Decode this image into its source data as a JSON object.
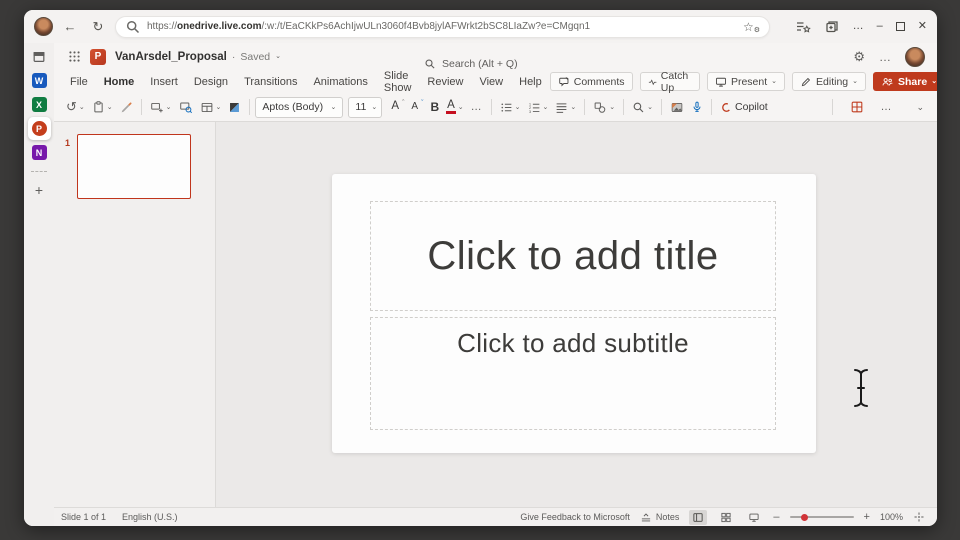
{
  "browser": {
    "url": {
      "prefix": "https://",
      "domain": "onedrive.live.com",
      "path": "/:w:/t/EaCKkPs6AchIjwULn3060f4Bvb8jylAFWrkt2bSC8LIaZw?e=CMgqn1"
    },
    "back_glyph": "←",
    "refresh_glyph": "↻",
    "more_glyph": "…",
    "minimize_glyph": "–",
    "close_glyph": "✕"
  },
  "app_rail": {
    "word_letter": "W",
    "excel_letter": "X",
    "powerpoint_letter": "P",
    "onenote_letter": "N",
    "new_button": "+"
  },
  "header": {
    "title": "VanArsdel_Proposal",
    "separator": "·",
    "save_status": "Saved",
    "search_placeholder": "Search (Alt + Q)",
    "gear_glyph": "⚙",
    "more_glyph": "…",
    "chevron": "⌄"
  },
  "menu": {
    "tabs": [
      "File",
      "Home",
      "Insert",
      "Design",
      "Transitions",
      "Animations",
      "Slide Show",
      "Review",
      "View",
      "Help"
    ],
    "active_tab": "Home",
    "comments": "Comments",
    "catch_up": "Catch Up",
    "present": "Present",
    "editing": "Editing",
    "share": "Share",
    "chevron": "⌄"
  },
  "ribbon": {
    "undo_glyph": "↺",
    "font_name": "Aptos (Body)",
    "font_size": "11",
    "grow_font": "A",
    "grow_mark": "ˆ",
    "shrink_font": "A",
    "shrink_mark": "ˇ",
    "bold": "B",
    "font_color": "A",
    "more_glyph": "…",
    "copilot": "Copilot",
    "chevron": "⌄"
  },
  "slide_panel": {
    "slide_number": "1"
  },
  "canvas": {
    "title_placeholder": "Click to add title",
    "subtitle_placeholder": "Click to add subtitle"
  },
  "status": {
    "slide_counter": "Slide 1 of 1",
    "language": "English (U.S.)",
    "feedback": "Give Feedback to Microsoft",
    "notes_label": "Notes",
    "zoom_out": "–",
    "zoom_in": "+",
    "zoom_level": "100%"
  },
  "colors": {
    "share_button": "#bf3a1d",
    "powerpoint_accent": "#c43e1c",
    "thumbnail_border": "#c0351c",
    "zoom_dot": "#d13438",
    "word": "#185abd",
    "excel": "#107c41",
    "onenote": "#7719aa",
    "dictate_mic": "#0f6cbd",
    "font_color_bar": "#c50f1f"
  }
}
